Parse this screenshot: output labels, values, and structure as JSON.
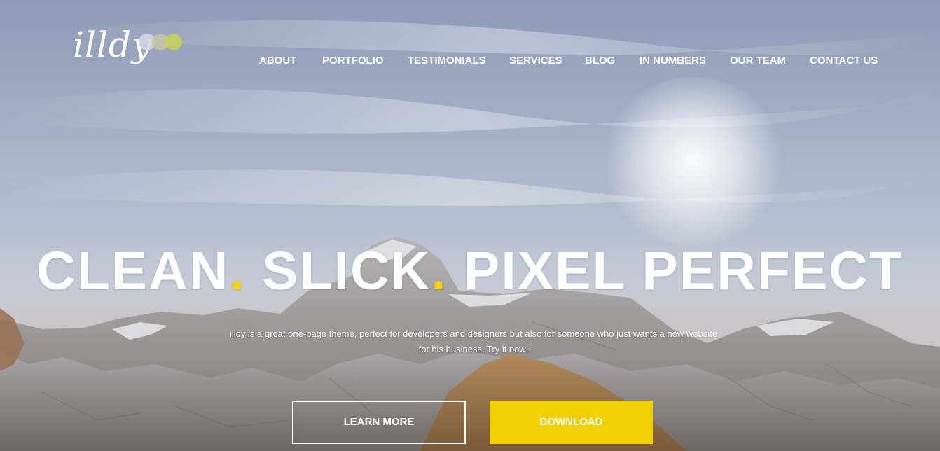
{
  "brand": {
    "logo_text": "illdy",
    "dot_colors": [
      "#d3d9e6",
      "#c8c5a4",
      "#c5d05a"
    ]
  },
  "nav": {
    "items": [
      {
        "label": "ABOUT"
      },
      {
        "label": "PORTFOLIO"
      },
      {
        "label": "TESTIMONIALS"
      },
      {
        "label": "SERVICES"
      },
      {
        "label": "BLOG"
      },
      {
        "label": "IN NUMBERS"
      },
      {
        "label": "OUR TEAM"
      },
      {
        "label": "CONTACT US"
      }
    ]
  },
  "hero": {
    "headline": {
      "word1": "CLEAN",
      "word2": "SLICK",
      "word3": "PIXEL PERFECT",
      "separator": "."
    },
    "tagline_line1": "illdy is a great one-page theme, perfect for developers and designers but also for someone who just wants a new website",
    "tagline_line2": "for his business. Try it now!",
    "learn_more_label": "LEARN MORE",
    "download_label": "DOWNLOAD"
  },
  "colors": {
    "accent": "#f2d008",
    "text": "#ffffff"
  }
}
